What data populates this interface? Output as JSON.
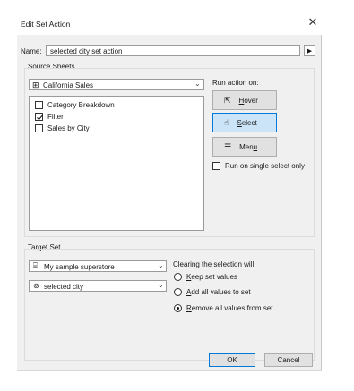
{
  "title": "Edit Set Action",
  "name_field": {
    "label_prefix": "N",
    "label_rest": "ame:",
    "value": "selected city set action"
  },
  "source_sheets": {
    "group_label": "Source Sheets",
    "dashboard_select": "California Sales",
    "sheets": [
      {
        "label": "Category Breakdown",
        "checked": false
      },
      {
        "label": "Filter",
        "checked": true
      },
      {
        "label": "Sales by City",
        "checked": false
      }
    ]
  },
  "run_action": {
    "label": "Run action on:",
    "hover": {
      "pre": "",
      "u": "H",
      "post": "over"
    },
    "select": {
      "pre": "",
      "u": "S",
      "post": "elect"
    },
    "menu": {
      "pre": "Men",
      "u": "u",
      "post": ""
    },
    "single_select": "Run on single select only",
    "selected_option": "Select"
  },
  "target_set": {
    "group_label": "Target Set",
    "datasource": "My sample superstore",
    "set": "selected city",
    "clearing_label": "Clearing the selection will:",
    "options": [
      {
        "pre": "",
        "u": "K",
        "post": "eep set values",
        "selected": false
      },
      {
        "pre": "",
        "u": "A",
        "post": "dd all values to set",
        "selected": false
      },
      {
        "pre": "",
        "u": "R",
        "post": "emove all values from set",
        "selected": true
      }
    ]
  },
  "buttons": {
    "ok": "OK",
    "cancel": "Cancel"
  }
}
